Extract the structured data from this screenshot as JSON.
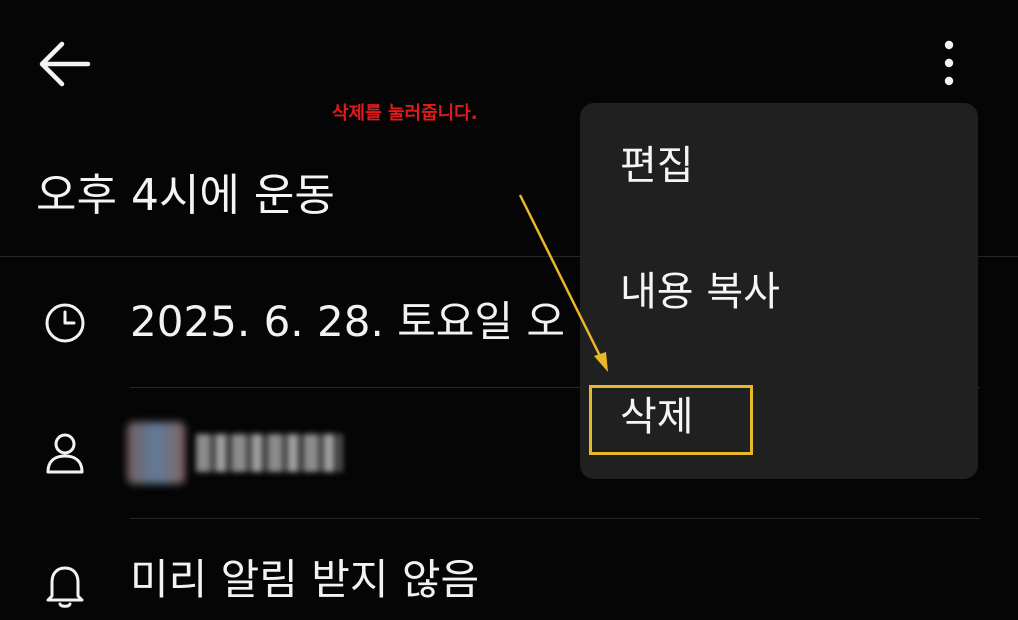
{
  "header": {
    "back_icon": "arrow-left-icon",
    "more_icon": "more-vertical-icon"
  },
  "event": {
    "title": "오후 4시에 운동",
    "datetime": "2025. 6. 28. 토요일 오",
    "reminder": "미리 알림 받지 않음"
  },
  "icons": {
    "clock": "clock-icon",
    "person": "person-icon",
    "bell": "bell-icon"
  },
  "menu": {
    "items": [
      {
        "label": "편집"
      },
      {
        "label": "내용 복사"
      },
      {
        "label": "삭제"
      }
    ]
  },
  "annotation": {
    "text": "삭제를 눌러줍니다.",
    "text_color": "#e01b1b",
    "arrow_color": "#e8b828",
    "box_color": "#e8b828"
  },
  "colors": {
    "background": "#050505",
    "menu_background": "#202020",
    "text": "#f2f2f2"
  }
}
